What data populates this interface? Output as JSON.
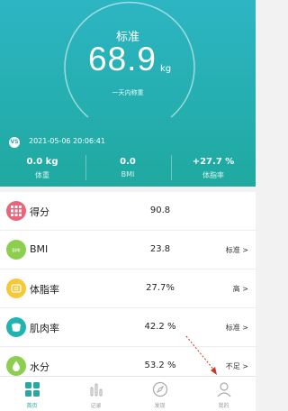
{
  "header": {
    "status_label": "标准",
    "weight": "68.9",
    "unit": "kg",
    "subtitle": "一天内称重",
    "badge": "VS",
    "datetime": "2021-05-06 20:06:41",
    "stats": [
      {
        "value": "0.0 kg",
        "label": "体重"
      },
      {
        "value": "0.0",
        "label": "BMI"
      },
      {
        "value": "+27.7 %",
        "label": "体脂率"
      }
    ]
  },
  "metrics": [
    {
      "name": "得分",
      "value": "90.8",
      "status": "",
      "icon": "score-grid-icon",
      "color": "#e9657a"
    },
    {
      "name": "BMI",
      "value": "23.8",
      "status": "标准 >",
      "icon": "bmi-icon",
      "color": "#8ccf4e"
    },
    {
      "name": "体脂率",
      "value": "27.7%",
      "status": "高 >",
      "icon": "body-fat-icon",
      "color": "#f5c83a"
    },
    {
      "name": "肌肉率",
      "value": "42.2 %",
      "status": "标准 >",
      "icon": "muscle-icon",
      "color": "#20b3b0"
    },
    {
      "name": "水分",
      "value": "53.2 %",
      "status": "不足 >",
      "icon": "water-drop-icon",
      "color": "#8ccf4e"
    }
  ],
  "tabs": [
    {
      "label": "首页",
      "icon": "home-grid-icon",
      "active": true
    },
    {
      "label": "记录",
      "icon": "chart-bars-icon",
      "active": false
    },
    {
      "label": "发现",
      "icon": "compass-icon",
      "active": false
    },
    {
      "label": "我的",
      "icon": "user-icon",
      "active": false
    }
  ],
  "colors": {
    "accent": "#2aa7a5",
    "annotation": "#c0392b"
  }
}
